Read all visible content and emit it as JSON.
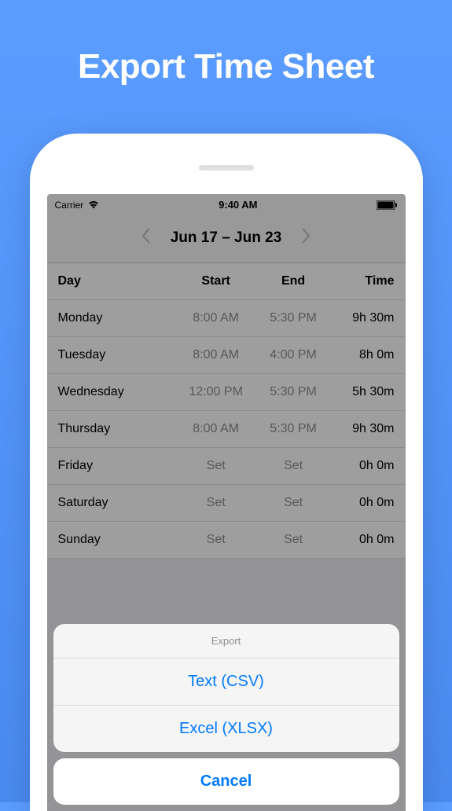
{
  "page": {
    "title": "Export Time Sheet"
  },
  "status_bar": {
    "carrier": "Carrier",
    "time": "9:40 AM"
  },
  "date_nav": {
    "range": "Jun 17 – Jun 23"
  },
  "table": {
    "headers": {
      "day": "Day",
      "start": "Start",
      "end": "End",
      "time": "Time"
    },
    "rows": [
      {
        "day": "Monday",
        "start": "8:00 AM",
        "end": "5:30 PM",
        "time": "9h 30m"
      },
      {
        "day": "Tuesday",
        "start": "8:00 AM",
        "end": "4:00 PM",
        "time": "8h 0m"
      },
      {
        "day": "Wednesday",
        "start": "12:00 PM",
        "end": "5:30 PM",
        "time": "5h 30m"
      },
      {
        "day": "Thursday",
        "start": "8:00 AM",
        "end": "5:30 PM",
        "time": "9h 30m"
      },
      {
        "day": "Friday",
        "start": "Set",
        "end": "Set",
        "time": "0h 0m"
      },
      {
        "day": "Saturday",
        "start": "Set",
        "end": "Set",
        "time": "0h 0m"
      },
      {
        "day": "Sunday",
        "start": "Set",
        "end": "Set",
        "time": "0h 0m"
      }
    ]
  },
  "action_sheet": {
    "title": "Export",
    "options": [
      "Text (CSV)",
      "Excel (XLSX)"
    ],
    "cancel": "Cancel"
  }
}
